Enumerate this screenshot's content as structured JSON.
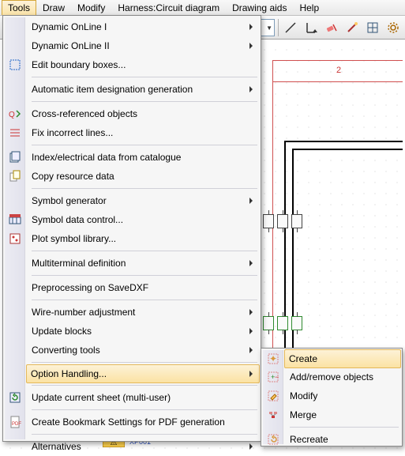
{
  "menubar": {
    "items": [
      {
        "label": "Tools"
      },
      {
        "label": "Draw"
      },
      {
        "label": "Modify"
      },
      {
        "label": "Harness:Circuit diagram"
      },
      {
        "label": "Drawing aids"
      },
      {
        "label": "Help"
      }
    ],
    "selected_index": 0
  },
  "canvas": {
    "column_label": "2",
    "bottom_tag": "XP001"
  },
  "main_menu": {
    "items": [
      {
        "label": "Dynamic OnLine I",
        "submenu": true,
        "icon": null
      },
      {
        "label": "Dynamic OnLine II",
        "submenu": true,
        "icon": null
      },
      {
        "label": "Edit boundary boxes...",
        "icon": "boundary-icon"
      },
      {
        "sep": true
      },
      {
        "label": "Automatic item designation generation",
        "submenu": true,
        "icon": null
      },
      {
        "sep": true
      },
      {
        "label": "Cross-referenced objects",
        "icon": "crossref-icon"
      },
      {
        "label": "Fix incorrect lines...",
        "icon": "fixlines-icon"
      },
      {
        "sep": true
      },
      {
        "label": "Index/electrical data from catalogue",
        "icon": "catalogue-icon"
      },
      {
        "label": "Copy resource data",
        "icon": "copyres-icon"
      },
      {
        "sep": true
      },
      {
        "label": "Symbol generator",
        "submenu": true,
        "icon": null
      },
      {
        "label": "Symbol data control...",
        "icon": "symdata-icon"
      },
      {
        "label": "Plot symbol library...",
        "icon": "plotsym-icon"
      },
      {
        "sep": true
      },
      {
        "label": "Multiterminal definition",
        "submenu": true,
        "icon": null
      },
      {
        "sep": true
      },
      {
        "label": "Preprocessing on SaveDXF",
        "icon": null
      },
      {
        "sep": true
      },
      {
        "label": "Wire-number adjustment",
        "submenu": true,
        "icon": null
      },
      {
        "label": "Update blocks",
        "submenu": true,
        "icon": null
      },
      {
        "label": "Converting tools",
        "submenu": true,
        "icon": null
      },
      {
        "sep": true
      },
      {
        "label": "Option Handling...",
        "submenu": true,
        "highlight": true,
        "icon": null
      },
      {
        "sep": true
      },
      {
        "label": "Update current sheet (multi-user)",
        "icon": "updatesheet-icon"
      },
      {
        "sep": true
      },
      {
        "label": "Create Bookmark Settings for PDF generation",
        "icon": "pdf-icon"
      },
      {
        "sep": true
      },
      {
        "label": "Alternatives",
        "submenu": true,
        "icon": null
      }
    ]
  },
  "sub_menu": {
    "items": [
      {
        "label": "Create",
        "highlight": true,
        "icon": "create-icon"
      },
      {
        "label": "Add/remove objects",
        "icon": "addremove-icon"
      },
      {
        "label": "Modify",
        "icon": "modify-icon"
      },
      {
        "label": "Merge",
        "icon": "merge-icon"
      },
      {
        "sep": true
      },
      {
        "label": "Recreate",
        "icon": "recreate-icon"
      }
    ]
  },
  "toolbar_icons": [
    "open-dropdown-icon",
    "line-icon",
    "indent-icon",
    "erase-icon",
    "wand-icon",
    "grid-icon",
    "settings-icon"
  ]
}
